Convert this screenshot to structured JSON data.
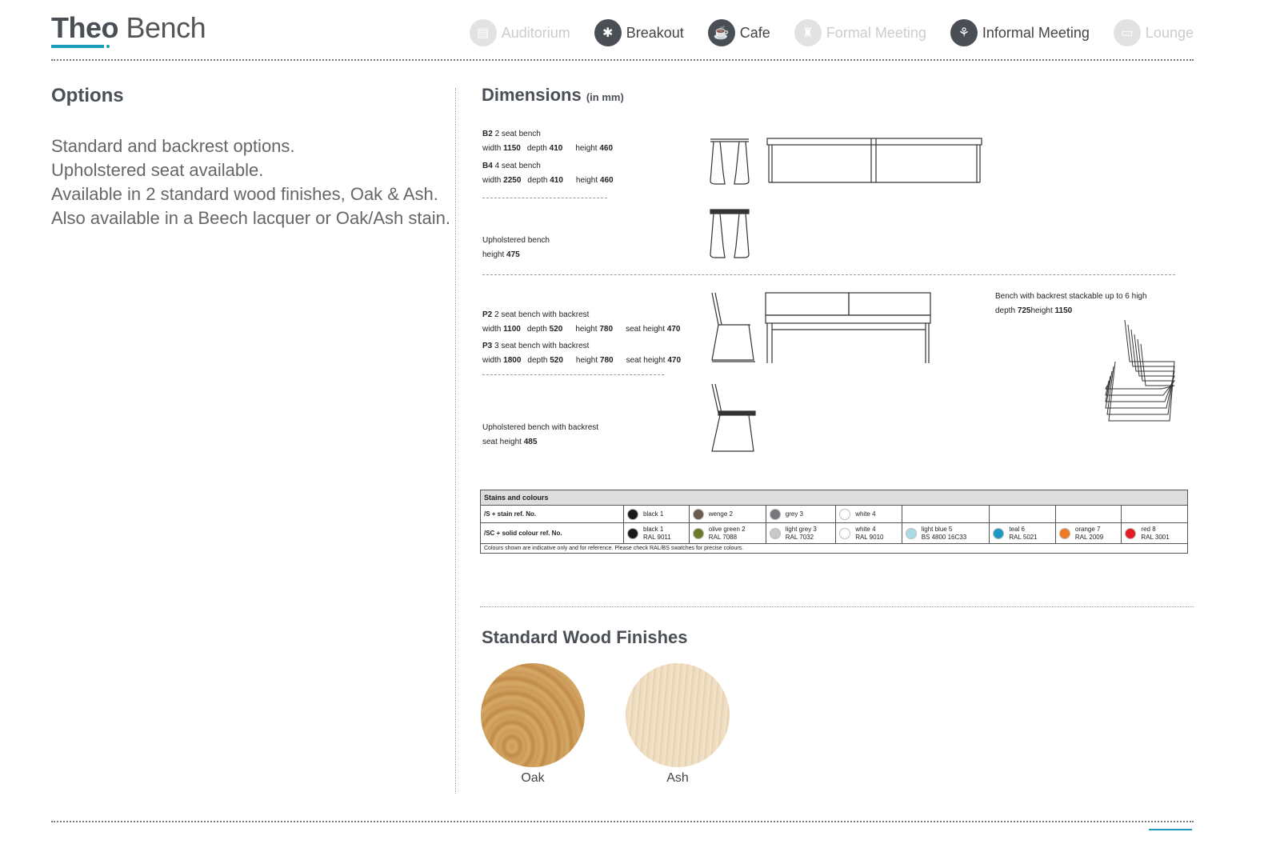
{
  "header": {
    "title_bold": "Theo",
    "title_light": "Bench",
    "nav": [
      {
        "label": "Auditorium",
        "icon": "auditorium-icon",
        "active": false
      },
      {
        "label": "Breakout",
        "icon": "breakout-icon",
        "active": true
      },
      {
        "label": "Cafe",
        "icon": "cafe-icon",
        "active": true
      },
      {
        "label": "Formal Meeting",
        "icon": "formal-meeting-icon",
        "active": false
      },
      {
        "label": "Informal Meeting",
        "icon": "informal-meeting-icon",
        "active": true
      },
      {
        "label": "Lounge",
        "icon": "lounge-icon",
        "active": false
      }
    ]
  },
  "options": {
    "heading": "Options",
    "lines": [
      "Standard and backrest options.",
      "Upholstered seat available.",
      "Available in 2 standard wood finishes, Oak & Ash.",
      "Also available in a Beech lacquer or Oak/Ash stain."
    ]
  },
  "dimensions": {
    "heading": "Dimensions",
    "unit": "(in mm)",
    "b2": {
      "code": "B2",
      "name": "2 seat bench",
      "width": "1150",
      "depth": "410",
      "height": "460"
    },
    "b4": {
      "code": "B4",
      "name": "4 seat bench",
      "width": "2250",
      "depth": "410",
      "height": "460"
    },
    "upholstered": {
      "name": "Upholstered bench",
      "height": "475"
    },
    "p2": {
      "code": "P2",
      "name": "2 seat bench with backrest",
      "width": "1100",
      "depth": "520",
      "height": "780",
      "seat_height": "470"
    },
    "p3": {
      "code": "P3",
      "name": "3 seat bench with backrest",
      "width": "1800",
      "depth": "520",
      "height": "780",
      "seat_height": "470"
    },
    "upholstered_backrest": {
      "name": "Upholstered bench with backrest",
      "seat_height": "485"
    },
    "stack": {
      "name": "Bench with backrest stackable up to 6 high",
      "depth": "725",
      "height": "1150"
    },
    "labels": {
      "width": "width",
      "depth": "depth",
      "height": "height",
      "seat_height": "seat height"
    }
  },
  "stains": {
    "header": "Stains and colours",
    "row1_label": "/S + stain ref. No.",
    "row2_label": "/SC + solid colour ref. No.",
    "row1": [
      {
        "name": "black 1",
        "color": "#1a1a1a"
      },
      {
        "name": "wenge 2",
        "color": "#6b5a50"
      },
      {
        "name": "grey 3",
        "color": "#77777c"
      },
      {
        "name": "white 4",
        "color": "#ffffff"
      }
    ],
    "row2": [
      {
        "name": "black 1",
        "ref": "RAL 9011",
        "color": "#1a1a1a"
      },
      {
        "name": "olive green 2",
        "ref": "RAL 7088",
        "color": "#6b7b2a"
      },
      {
        "name": "light grey 3",
        "ref": "RAL 7032",
        "color": "#c8c8c8"
      },
      {
        "name": "white 4",
        "ref": "RAL 9010",
        "color": "#ffffff"
      },
      {
        "name": "light blue 5",
        "ref": "BS 4800 16C33",
        "color": "#a9dce8"
      },
      {
        "name": "teal 6",
        "ref": "RAL 5021",
        "color": "#1a9bc4"
      },
      {
        "name": "orange 7",
        "ref": "RAL 2009",
        "color": "#ef7a22"
      },
      {
        "name": "red 8",
        "ref": "RAL 3001",
        "color": "#e31b23"
      }
    ],
    "note": "Colours shown are indicative only and for reference. Please check RAL/BS swatches for precise colours."
  },
  "wood": {
    "heading": "Standard Wood Finishes",
    "finishes": [
      "Oak",
      "Ash"
    ]
  },
  "colors": {
    "accent": "#1a9bb8",
    "heading": "#4a4f55"
  }
}
